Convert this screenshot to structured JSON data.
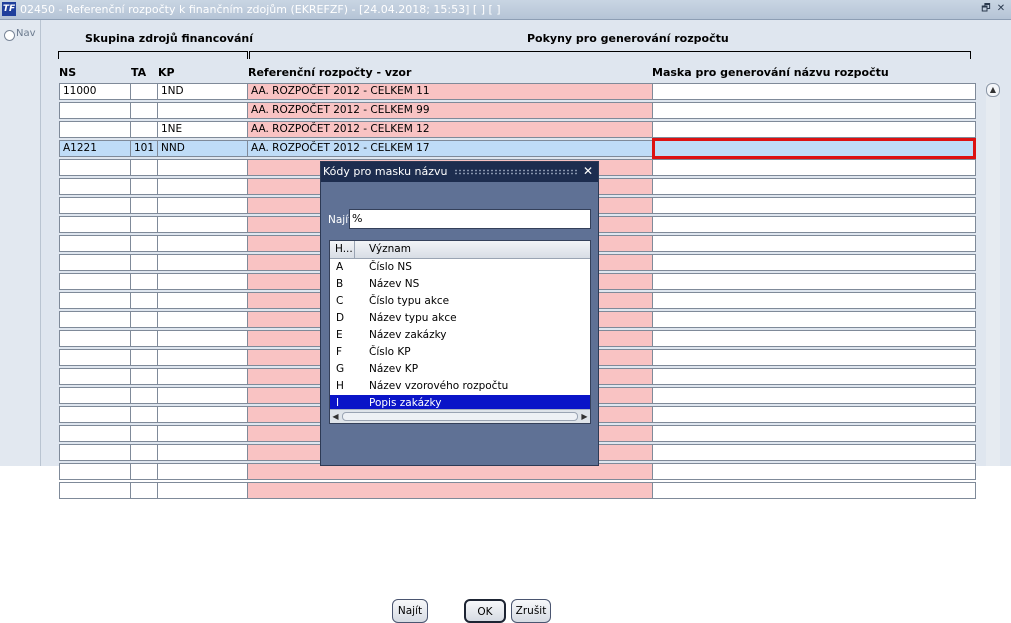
{
  "window": {
    "title": "02450 - Referenční rozpočty k finančním zdojům (EKREFZF) - [24.04.2018; 15:53]  [ ]  [ ]",
    "app_icon": "TF",
    "controls": {
      "restore": "🗗",
      "close": "✕"
    }
  },
  "nav": {
    "label": "Nav"
  },
  "headers": {
    "group_left": "Skupina zdrojů financování",
    "group_right": "Pokyny pro generování rozpočtu",
    "col_ns": "NS",
    "col_ta": "TA",
    "col_kp": "KP",
    "col_ref": "Referenční rozpočty - vzor",
    "col_mask": "Maska pro generování názvu rozpočtu"
  },
  "rows": [
    {
      "ns": "11000",
      "ta": "",
      "kp": "1ND",
      "ref": "AA. ROZPOČET 2012 - CELKEM 11",
      "mask": ""
    },
    {
      "ns": "",
      "ta": "",
      "kp": "",
      "ref": "AA. ROZPOČET 2012 - CELKEM 99",
      "mask": ""
    },
    {
      "ns": "",
      "ta": "",
      "kp": "1NE",
      "ref": "AA. ROZPOČET 2012 - CELKEM 12",
      "mask": ""
    },
    {
      "ns": "A1221",
      "ta": "101",
      "kp": "NND",
      "ref": "AA. ROZPOČET 2012 - CELKEM 17",
      "mask": ""
    }
  ],
  "dialog": {
    "title": "Kódy pro masku názvu",
    "find_label": "Najít",
    "find_value": "%",
    "list_headers": {
      "code": "H...",
      "meaning": "Význam"
    },
    "items": [
      {
        "code": "A",
        "meaning": "Číslo NS"
      },
      {
        "code": "B",
        "meaning": "Název NS"
      },
      {
        "code": "C",
        "meaning": "Číslo typu akce"
      },
      {
        "code": "D",
        "meaning": "Název typu akce"
      },
      {
        "code": "E",
        "meaning": "Název zakázky"
      },
      {
        "code": "F",
        "meaning": "Číslo KP"
      },
      {
        "code": "G",
        "meaning": "Název KP"
      },
      {
        "code": "H",
        "meaning": "Název vzorového rozpočtu"
      },
      {
        "code": "I",
        "meaning": "Popis zakázky"
      }
    ],
    "selected_index": 8,
    "buttons": {
      "find": "Najít",
      "ok": "OK",
      "cancel": "Zrušit"
    }
  },
  "colors": {
    "title_bar": "#c9d5e3",
    "pink_cell": "#f9c3c3",
    "current_row": "#bfdcf7",
    "focus_border": "#dd1111",
    "dialog_bg": "#5f7195",
    "dialog_title": "#1d2d4f",
    "list_selection": "#0a14c8"
  },
  "icons": {
    "app": "app-logo-icon",
    "restore": "restore-icon",
    "close": "close-icon",
    "scroll_up": "scroll-up-icon",
    "scroll_left": "scroll-left-icon",
    "scroll_right": "scroll-right-icon"
  }
}
